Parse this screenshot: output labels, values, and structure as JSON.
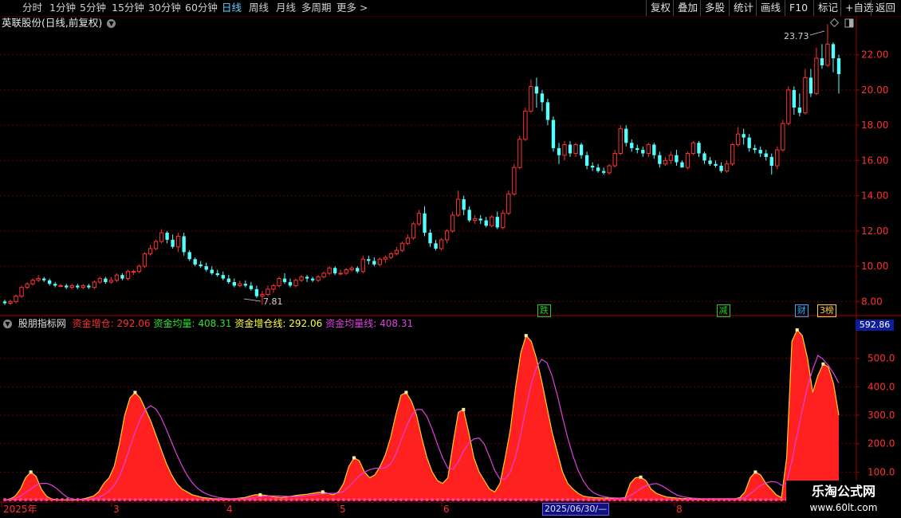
{
  "toolbar": {
    "periods": [
      "分时",
      "1分钟",
      "5分钟",
      "15分钟",
      "30分钟",
      "60分钟",
      "日线",
      "周线",
      "月线",
      "多周期",
      "更多"
    ],
    "active_period": "日线",
    "more_arrow": ">",
    "right_buttons": [
      "复权",
      "叠加",
      "多股",
      "统计",
      "画线",
      "F10",
      "标记",
      "+自选",
      "返回"
    ]
  },
  "header": {
    "title": "英联股份(日线,前复权)",
    "dropdown_icon": "chevron-down-icon"
  },
  "main_chart": {
    "y_ticks": [
      "22.00",
      "20.00",
      "18.00",
      "16.00",
      "14.00",
      "12.00",
      "10.00",
      "8.00"
    ],
    "high_label": "23.73",
    "low_label": "7.81",
    "events": [
      {
        "text": "跌",
        "color": "#22cc22"
      },
      {
        "text": "减",
        "color": "#22cc22"
      },
      {
        "text": "财",
        "color": "#33aaff"
      },
      {
        "text": "3榜",
        "color": "#ffcc44"
      }
    ]
  },
  "indicator": {
    "name": "股朋指标网",
    "fields": [
      {
        "label": "资金增仓:",
        "value": "292.06",
        "color": "#ff3030"
      },
      {
        "label": "资金均量:",
        "value": "408.31",
        "color": "#30e030"
      },
      {
        "label": "资金增仓线:",
        "value": "292.06",
        "color": "#ffff40"
      },
      {
        "label": "资金均量线:",
        "value": "408.31",
        "color": "#e040e0"
      }
    ],
    "y_ticks": [
      "500.0",
      "400.0",
      "300.0",
      "200.0",
      "100.0"
    ],
    "current_value": "592.86"
  },
  "x_axis": {
    "labels": [
      "2025年",
      "3",
      "4",
      "5",
      "6",
      "7",
      "8"
    ],
    "cursor_date": "2025/06/30/—"
  },
  "watermark": {
    "line1": "乐淘公式网",
    "line2": "www.60lt.com"
  },
  "colors": {
    "up": "#ff3232",
    "down": "#54ffff",
    "grid": "#6a0000",
    "axis": "#a00000"
  },
  "chart_data": [
    {
      "type": "candlestick",
      "title": "英联股份(日线,前复权)",
      "ylim": [
        7.2,
        24.2
      ],
      "yticks": [
        8,
        10,
        12,
        14,
        16,
        18,
        20,
        22
      ],
      "candles": [
        [
          8.0,
          7.9,
          8.1,
          7.8
        ],
        [
          7.9,
          8.0,
          8.1,
          7.8
        ],
        [
          8.0,
          8.3,
          8.4,
          7.9
        ],
        [
          8.3,
          8.8,
          8.9,
          8.2
        ],
        [
          8.8,
          9.0,
          9.1,
          8.7
        ],
        [
          9.0,
          9.2,
          9.3,
          8.9
        ],
        [
          9.2,
          9.3,
          9.5,
          9.1
        ],
        [
          9.3,
          9.2,
          9.4,
          9.1
        ],
        [
          9.2,
          9.0,
          9.3,
          8.9
        ],
        [
          9.0,
          8.9,
          9.1,
          8.8
        ],
        [
          8.9,
          8.9,
          9.0,
          8.8
        ],
        [
          8.9,
          8.8,
          9.0,
          8.7
        ],
        [
          8.8,
          8.9,
          9.0,
          8.7
        ],
        [
          8.9,
          8.8,
          9.0,
          8.7
        ],
        [
          8.8,
          8.9,
          9.0,
          8.7
        ],
        [
          8.9,
          8.8,
          9.0,
          8.7
        ],
        [
          8.8,
          9.1,
          9.2,
          8.7
        ],
        [
          9.1,
          9.3,
          9.4,
          9.0
        ],
        [
          9.3,
          9.1,
          9.4,
          9.0
        ],
        [
          9.1,
          9.2,
          9.4,
          9.0
        ],
        [
          9.2,
          9.5,
          9.6,
          9.1
        ],
        [
          9.5,
          9.3,
          9.6,
          9.2
        ],
        [
          9.3,
          9.7,
          9.8,
          9.2
        ],
        [
          9.7,
          9.7,
          9.8,
          9.5
        ],
        [
          9.7,
          10.0,
          10.1,
          9.6
        ],
        [
          10.0,
          10.7,
          10.8,
          9.9
        ],
        [
          10.7,
          11.0,
          11.2,
          10.6
        ],
        [
          11.0,
          11.4,
          11.5,
          10.9
        ],
        [
          11.4,
          11.9,
          12.1,
          11.3
        ],
        [
          11.9,
          11.5,
          12.0,
          11.3
        ],
        [
          11.5,
          11.1,
          11.8,
          11.0
        ],
        [
          11.1,
          11.7,
          11.9,
          10.8
        ],
        [
          11.7,
          10.8,
          11.9,
          10.6
        ],
        [
          10.8,
          10.4,
          10.9,
          10.3
        ],
        [
          10.4,
          10.1,
          10.5,
          10.0
        ],
        [
          10.1,
          10.0,
          10.3,
          9.9
        ],
        [
          10.0,
          9.8,
          10.2,
          9.7
        ],
        [
          9.8,
          9.6,
          10.0,
          9.5
        ],
        [
          9.6,
          9.5,
          9.8,
          9.4
        ],
        [
          9.5,
          9.3,
          9.7,
          9.2
        ],
        [
          9.3,
          9.1,
          9.5,
          9.0
        ],
        [
          9.1,
          8.9,
          9.3,
          8.8
        ],
        [
          8.9,
          9.0,
          9.2,
          8.8
        ],
        [
          9.0,
          8.9,
          9.2,
          8.8
        ],
        [
          8.9,
          8.7,
          9.1,
          8.6
        ],
        [
          8.7,
          8.3,
          8.9,
          8.2
        ],
        [
          8.3,
          8.4,
          8.6,
          7.81
        ],
        [
          8.4,
          8.7,
          8.9,
          8.3
        ],
        [
          8.7,
          8.9,
          9.0,
          8.5
        ],
        [
          8.9,
          9.3,
          9.4,
          8.8
        ],
        [
          9.3,
          9.1,
          9.6,
          9.0
        ],
        [
          9.1,
          8.9,
          9.3,
          8.8
        ],
        [
          8.9,
          9.2,
          9.3,
          8.8
        ],
        [
          9.2,
          9.4,
          9.5,
          9.1
        ],
        [
          9.4,
          9.3,
          9.5,
          9.1
        ],
        [
          9.3,
          9.2,
          9.4,
          9.1
        ],
        [
          9.2,
          9.4,
          9.5,
          9.1
        ],
        [
          9.4,
          9.6,
          9.7,
          9.3
        ],
        [
          9.6,
          9.9,
          10.0,
          9.5
        ],
        [
          9.9,
          9.6,
          10.0,
          9.5
        ],
        [
          9.6,
          9.6,
          9.8,
          9.5
        ],
        [
          9.6,
          9.8,
          9.9,
          9.5
        ],
        [
          9.8,
          9.9,
          10.0,
          9.7
        ],
        [
          9.9,
          9.7,
          10.0,
          9.6
        ],
        [
          9.7,
          10.4,
          10.6,
          9.6
        ],
        [
          10.4,
          10.3,
          10.6,
          10.1
        ],
        [
          10.3,
          10.1,
          10.5,
          10.0
        ],
        [
          10.1,
          10.4,
          10.5,
          10.0
        ],
        [
          10.4,
          10.5,
          10.6,
          10.2
        ],
        [
          10.5,
          10.7,
          10.8,
          10.4
        ],
        [
          10.7,
          10.9,
          11.1,
          10.6
        ],
        [
          10.9,
          11.3,
          11.4,
          10.8
        ],
        [
          11.3,
          11.6,
          11.8,
          11.2
        ],
        [
          11.6,
          12.4,
          12.5,
          11.5
        ],
        [
          12.4,
          13.0,
          13.2,
          12.3
        ],
        [
          13.0,
          11.9,
          13.4,
          11.7
        ],
        [
          11.9,
          11.3,
          12.1,
          11.1
        ],
        [
          11.3,
          11.0,
          11.5,
          10.9
        ],
        [
          11.0,
          11.5,
          11.6,
          10.9
        ],
        [
          11.5,
          12.0,
          12.1,
          11.3
        ],
        [
          12.0,
          12.9,
          13.1,
          11.9
        ],
        [
          12.9,
          13.8,
          14.3,
          12.8
        ],
        [
          13.8,
          13.2,
          14.0,
          12.9
        ],
        [
          13.2,
          12.6,
          13.4,
          12.5
        ],
        [
          12.6,
          12.7,
          12.9,
          12.4
        ],
        [
          12.7,
          12.6,
          12.9,
          12.4
        ],
        [
          12.6,
          12.3,
          12.8,
          12.2
        ],
        [
          12.3,
          12.8,
          12.9,
          12.2
        ],
        [
          12.8,
          12.2,
          13.1,
          12.1
        ],
        [
          12.2,
          13.0,
          13.2,
          12.1
        ],
        [
          13.0,
          14.1,
          14.3,
          12.9
        ],
        [
          14.1,
          15.6,
          15.8,
          14.0
        ],
        [
          15.6,
          17.2,
          17.4,
          15.5
        ],
        [
          17.2,
          18.8,
          19.0,
          17.1
        ],
        [
          18.8,
          20.2,
          20.6,
          18.7
        ],
        [
          20.2,
          19.8,
          20.7,
          19.0
        ],
        [
          19.8,
          19.3,
          20.0,
          18.8
        ],
        [
          19.3,
          18.3,
          19.5,
          18.0
        ],
        [
          18.3,
          16.7,
          18.5,
          16.5
        ],
        [
          16.7,
          16.3,
          17.0,
          15.8
        ],
        [
          16.3,
          16.9,
          17.1,
          16.0
        ],
        [
          16.9,
          16.4,
          17.1,
          16.2
        ],
        [
          16.4,
          16.9,
          17.0,
          16.2
        ],
        [
          16.9,
          16.3,
          17.0,
          16.1
        ],
        [
          16.3,
          15.7,
          16.5,
          15.5
        ],
        [
          15.7,
          15.6,
          15.9,
          15.4
        ],
        [
          15.6,
          15.4,
          15.8,
          15.3
        ],
        [
          15.4,
          15.3,
          15.6,
          15.2
        ],
        [
          15.3,
          15.7,
          15.8,
          15.2
        ],
        [
          15.7,
          16.4,
          16.6,
          15.6
        ],
        [
          16.4,
          17.8,
          18.0,
          16.3
        ],
        [
          17.8,
          17.0,
          18.0,
          16.8
        ],
        [
          17.0,
          16.7,
          17.2,
          16.5
        ],
        [
          16.7,
          16.6,
          16.9,
          16.4
        ],
        [
          16.6,
          16.4,
          16.8,
          16.2
        ],
        [
          16.4,
          16.9,
          17.0,
          16.2
        ],
        [
          16.9,
          16.3,
          17.0,
          16.1
        ],
        [
          16.3,
          15.8,
          16.5,
          15.6
        ],
        [
          15.8,
          16.0,
          16.2,
          15.7
        ],
        [
          16.0,
          16.3,
          16.5,
          15.8
        ],
        [
          16.3,
          15.9,
          16.6,
          15.7
        ],
        [
          15.9,
          15.6,
          16.0,
          15.6
        ],
        [
          15.6,
          16.4,
          16.5,
          15.5
        ],
        [
          16.4,
          17.0,
          17.1,
          16.3
        ],
        [
          17.0,
          16.4,
          17.1,
          16.2
        ],
        [
          16.4,
          16.0,
          16.5,
          15.8
        ],
        [
          16.0,
          15.8,
          16.2,
          15.7
        ],
        [
          15.8,
          15.7,
          16.0,
          15.6
        ],
        [
          15.7,
          15.4,
          15.9,
          15.3
        ],
        [
          15.4,
          15.8,
          16.0,
          15.3
        ],
        [
          15.8,
          16.9,
          17.0,
          15.7
        ],
        [
          16.9,
          17.5,
          17.9,
          16.8
        ],
        [
          17.5,
          17.3,
          17.8,
          16.9
        ],
        [
          17.3,
          16.7,
          17.5,
          16.5
        ],
        [
          16.7,
          16.6,
          16.9,
          16.4
        ],
        [
          16.6,
          16.4,
          16.8,
          16.2
        ],
        [
          16.4,
          16.2,
          16.6,
          16.0
        ],
        [
          16.2,
          15.7,
          16.4,
          15.2
        ],
        [
          15.7,
          16.6,
          16.8,
          15.5
        ],
        [
          16.6,
          18.1,
          18.3,
          16.5
        ],
        [
          18.1,
          20.0,
          20.2,
          18.0
        ],
        [
          20.0,
          19.0,
          20.2,
          18.6
        ],
        [
          19.0,
          18.7,
          19.8,
          18.5
        ],
        [
          18.7,
          20.7,
          21.2,
          18.6
        ],
        [
          20.7,
          19.8,
          21.2,
          19.6
        ],
        [
          19.8,
          21.8,
          22.4,
          19.7
        ],
        [
          21.8,
          21.4,
          22.6,
          21.2
        ],
        [
          21.4,
          22.6,
          23.73,
          21.3
        ],
        [
          22.6,
          21.8,
          22.7,
          21.0
        ],
        [
          21.8,
          20.9,
          22.0,
          19.8
        ]
      ]
    },
    {
      "type": "area",
      "title": "股朋指标网",
      "ylim": [
        0,
        600
      ],
      "yticks": [
        100,
        200,
        300,
        400,
        500
      ],
      "series": [
        {
          "name": "资金增仓",
          "color": "#ff2020",
          "values": [
            0,
            5,
            15,
            40,
            80,
            100,
            85,
            40,
            15,
            5,
            2,
            2,
            2,
            2,
            2,
            5,
            10,
            15,
            30,
            60,
            80,
            120,
            200,
            300,
            360,
            380,
            360,
            320,
            280,
            230,
            180,
            130,
            90,
            60,
            40,
            30,
            20,
            15,
            10,
            8,
            6,
            5,
            5,
            5,
            6,
            8,
            10,
            15,
            20,
            20,
            18,
            15,
            12,
            10,
            12,
            15,
            18,
            20,
            22,
            25,
            28,
            30,
            25,
            20,
            30,
            60,
            120,
            150,
            140,
            100,
            80,
            90,
            120,
            160,
            220,
            300,
            370,
            380,
            350,
            300,
            220,
            150,
            100,
            70,
            60,
            80,
            200,
            310,
            320,
            240,
            150,
            100,
            70,
            40,
            30,
            60,
            150,
            250,
            400,
            520,
            580,
            560,
            500,
            420,
            330,
            240,
            170,
            100,
            60,
            40,
            25,
            15,
            12,
            10,
            9,
            8,
            8,
            8,
            8,
            10,
            60,
            80,
            82,
            70,
            40,
            25,
            18,
            12,
            10,
            8,
            7,
            6,
            6,
            5,
            5,
            6,
            6,
            6,
            6,
            6,
            6,
            10,
            30,
            80,
            100,
            90,
            60,
            40,
            20,
            10,
            150,
            560,
            600,
            580,
            500,
            380,
            440,
            480,
            470,
            410,
            300
          ]
        }
      ]
    }
  ]
}
